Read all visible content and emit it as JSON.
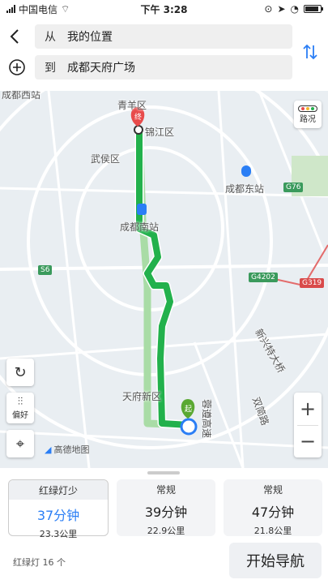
{
  "status_bar": {
    "carrier": "中国电信",
    "time": "下午 3:28"
  },
  "header": {
    "from_prefix": "从",
    "from_value": "我的位置",
    "to_prefix": "到",
    "to_value": "成都天府广场"
  },
  "map": {
    "labels": {
      "qingyang": "青羊区",
      "jinjiang": "锦江区",
      "wuhou": "武侯区",
      "chengdu_east": "成都东站",
      "chengdu_south": "成都南站",
      "tianfu_new": "天府新区",
      "xinxing": "新兴特大桥",
      "shuangjian": "双简路",
      "rongzun": "蓉遵高速",
      "west_station": "成都西站"
    },
    "road_badges": {
      "g76": "G76",
      "s6": "S6",
      "g4202": "G4202",
      "g319": "G319"
    },
    "end_marker": "终",
    "start_marker": "起",
    "traffic_label": "路况",
    "preference_label": "偏好",
    "logo_text": "高德地图",
    "zoom_in": "+",
    "zoom_out": "−",
    "colors": {
      "route": "#22b14c",
      "alt_route": "#a9dca6",
      "end_pin": "#e84b4b",
      "start_pin": "#5aa832",
      "station": "#2a7ef5"
    }
  },
  "routes": [
    {
      "tag": "红绿灯少",
      "time": "37分钟",
      "distance": "23.3公里"
    },
    {
      "tag": "常规",
      "time": "39分钟",
      "distance": "22.9公里"
    },
    {
      "tag": "常规",
      "time": "47分钟",
      "distance": "21.8公里"
    }
  ],
  "traffic_lights": "红绿灯 16 个",
  "start_navigation": "开始导航"
}
